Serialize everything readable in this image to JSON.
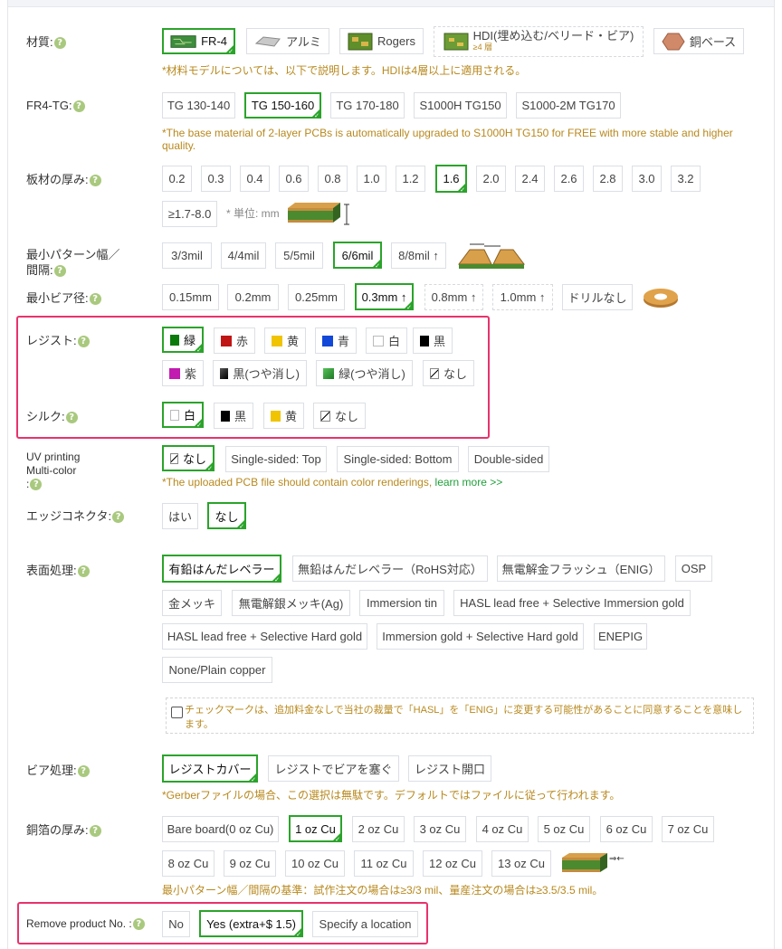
{
  "material": {
    "label": "材質:",
    "options": [
      "FR-4",
      "アルミ",
      "Rogers",
      "HDI(埋め込む/ベリード・ビア)",
      "銅ベース"
    ],
    "hdi_sub": "≥4 層",
    "selected": "FR-4",
    "note": "*材料モデルについては、以下で説明します。HDIは4層以上に適用される。"
  },
  "fr4tg": {
    "label": "FR4-TG:",
    "options": [
      "TG 130-140",
      "TG 150-160",
      "TG 170-180",
      "S1000H TG150",
      "S1000-2M TG170"
    ],
    "selected": "TG 150-160",
    "note": "*The base material of 2-layer PCBs is automatically upgraded to S1000H TG150 for FREE with more stable and higher quality."
  },
  "thickness": {
    "label": "板材の厚み:",
    "options": [
      "0.2",
      "0.3",
      "0.4",
      "0.6",
      "0.8",
      "1.0",
      "1.2",
      "1.6",
      "2.0",
      "2.4",
      "2.6",
      "2.8",
      "3.0",
      "3.2",
      "≥1.7-8.0"
    ],
    "selected": "1.6",
    "unit": "* 単位: mm"
  },
  "trace": {
    "label1": "最小パターン幅／",
    "label2": "間隔:",
    "options": [
      "3/3mil",
      "4/4mil",
      "5/5mil",
      "6/6mil",
      "8/8mil ↑"
    ],
    "selected": "6/6mil"
  },
  "via": {
    "label": "最小ビア径:",
    "options": [
      "0.15mm",
      "0.2mm",
      "0.25mm",
      "0.3mm ↑",
      "0.8mm ↑",
      "1.0mm ↑",
      "ドリルなし"
    ],
    "selected": "0.3mm ↑"
  },
  "resist": {
    "label": "レジスト:",
    "options": [
      "緑",
      "赤",
      "黄",
      "青",
      "白",
      "黒",
      "紫",
      "黒(つや消し)",
      "緑(つや消し)",
      "なし"
    ],
    "selected": "緑",
    "colors": [
      "#0a7a0a",
      "#c01515",
      "#f0c400",
      "#1248d8",
      "#ffffff",
      "#000000",
      "#c21bb0",
      "#1d1d1d",
      "#2e9e36",
      "none"
    ]
  },
  "silk": {
    "label": "シルク:",
    "options": [
      "白",
      "黒",
      "黄",
      "なし"
    ],
    "selected": "白",
    "colors": [
      "#ffffff",
      "#000000",
      "#f0c400",
      "none"
    ]
  },
  "uv": {
    "label1": "UV printing",
    "label2": "Multi-color",
    "label3": ":",
    "options": [
      "なし",
      "Single-sided: Top",
      "Single-sided: Bottom",
      "Double-sided"
    ],
    "selected": "なし",
    "note": "*The uploaded PCB file should contain color renderings, ",
    "learn_more": "learn more >>"
  },
  "edge": {
    "label": "エッジコネクタ:",
    "options": [
      "はい",
      "なし"
    ],
    "selected": "なし"
  },
  "surface": {
    "label": "表面処理:",
    "options": [
      "有鉛はんだレベラー",
      "無鉛はんだレベラー（RoHS対応）",
      "無電解金フラッシュ（ENIG）",
      "OSP",
      "金メッキ",
      "無電解銀メッキ(Ag)",
      "Immersion tin",
      "HASL lead free + Selective Immersion gold",
      "HASL lead free + Selective Hard gold",
      "Immersion gold + Selective Hard gold",
      "ENEPIG",
      "None/Plain copper"
    ],
    "selected": "有鉛はんだレベラー",
    "checkbox_text": "チェックマークは、追加料金なしで当社の裁量で「HASL」を「ENIG」に変更する可能性があることに同意することを意味します。"
  },
  "via_process": {
    "label": "ビア処理:",
    "options": [
      "レジストカバー",
      "レジストでビアを塞ぐ",
      "レジスト開口"
    ],
    "selected": "レジストカバー",
    "note": "*Gerberファイルの場合、この選択は無駄です。デフォルトではファイルに従って行われます。"
  },
  "copper": {
    "label": "銅箔の厚み:",
    "options": [
      "Bare board(0 oz Cu)",
      "1 oz Cu",
      "2 oz Cu",
      "3 oz Cu",
      "4 oz Cu",
      "5 oz Cu",
      "6 oz Cu",
      "7 oz Cu",
      "8 oz Cu",
      "9 oz Cu",
      "10 oz Cu",
      "11 oz Cu",
      "12 oz Cu",
      "13 oz Cu"
    ],
    "selected": "1 oz Cu",
    "note": "最小パターン幅／間隔の基準：試作注文の場合は≥3/3 mil、量産注文の場合は≥3.5/3.5 mil。"
  },
  "remove_no": {
    "label": "Remove product No. :",
    "options": [
      "No",
      "Yes (extra+$ 1.5)",
      "Specify a location"
    ],
    "selected": "Yes (extra+$ 1.5)"
  },
  "help_icon_glyph": "?"
}
